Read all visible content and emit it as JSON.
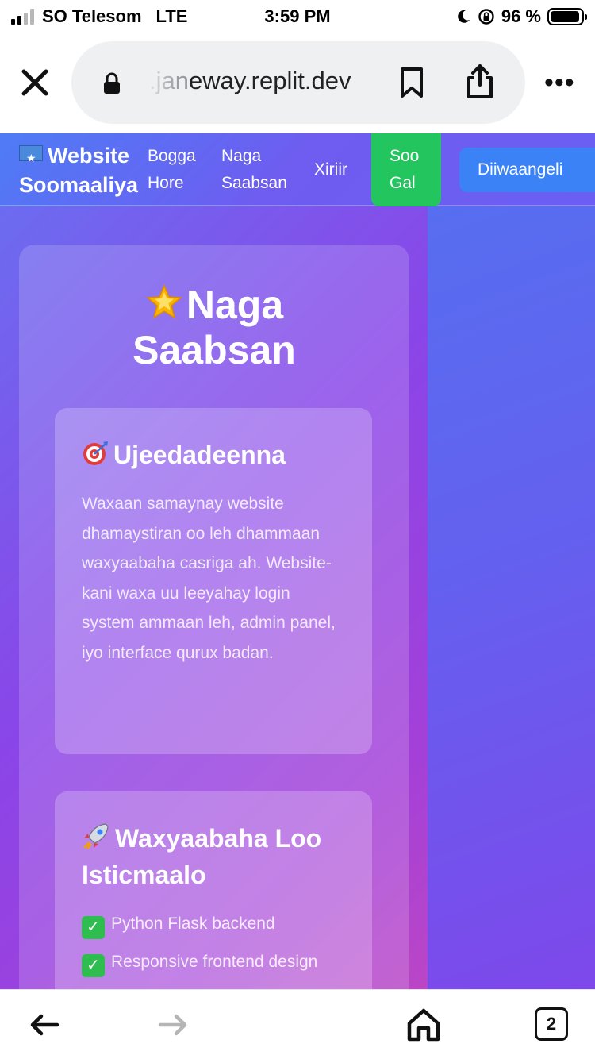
{
  "status_bar": {
    "carrier": "SO Telesom",
    "network": "LTE",
    "time": "3:59 PM",
    "battery": "96 %",
    "battery_level": 0.96
  },
  "browser": {
    "url_dim": ".jan",
    "url_main": "eway.replit.dev",
    "tab_count": "2"
  },
  "navbar": {
    "brand_line1": "Website",
    "brand_line2": "Soomaaliya",
    "links": [
      {
        "line1": "Bogga",
        "line2": "Hore"
      },
      {
        "line1": "Naga",
        "line2": "Saabsan"
      },
      {
        "line1": "Xiriir",
        "line2": ""
      }
    ],
    "login": {
      "line1": "Soo",
      "line2": "Gal"
    },
    "register": "Diiwaangeli"
  },
  "page": {
    "title_line1": "Naga",
    "title_line2": "Saabsan",
    "cards": [
      {
        "title": "Ujeedadeenna",
        "body": "Waxaan samaynay website dhamaystiran oo leh dhammaan waxyaabaha casriga ah. Website-kani waxa uu leeyahay login system ammaan leh, admin panel, iyo interface qurux badan."
      },
      {
        "title": "Waxyaabaha Loo Isticmaalo",
        "features": [
          "Python Flask backend",
          "Responsive frontend design"
        ]
      }
    ]
  },
  "colors": {
    "login_button": "#22c55e",
    "register_button": "#3b82f6",
    "gradient_start": "#4f76f0",
    "gradient_end": "#bb46c6"
  }
}
